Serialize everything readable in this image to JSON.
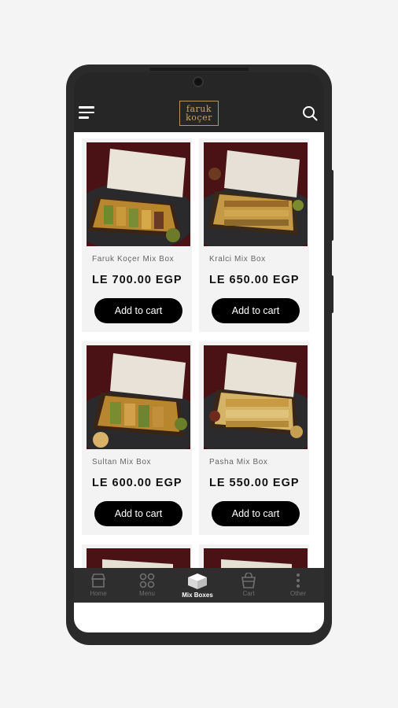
{
  "header": {
    "logo_line1": "faruk",
    "logo_line2": "koçer"
  },
  "products": [
    {
      "name": "Faruk Koçer Mix Box",
      "price": "LE 700.00 EGP",
      "button": "Add to cart"
    },
    {
      "name": "Kralci Mix Box",
      "price": "LE 650.00 EGP",
      "button": "Add to cart"
    },
    {
      "name": "Sultan Mix Box",
      "price": "LE 600.00 EGP",
      "button": "Add to cart"
    },
    {
      "name": "Pasha Mix Box",
      "price": "LE 550.00 EGP",
      "button": "Add to cart"
    }
  ],
  "nav": [
    {
      "label": "Home",
      "icon": "store-icon"
    },
    {
      "label": "Menu",
      "icon": "grid-icon"
    },
    {
      "label": "Mix Boxes",
      "icon": "box-icon",
      "active": true
    },
    {
      "label": "Cart",
      "icon": "bag-icon"
    },
    {
      "label": "Other",
      "icon": "more-icon"
    }
  ],
  "colors": {
    "accent_gold": "#b9975b",
    "dark": "#262626",
    "button": "#000000"
  }
}
